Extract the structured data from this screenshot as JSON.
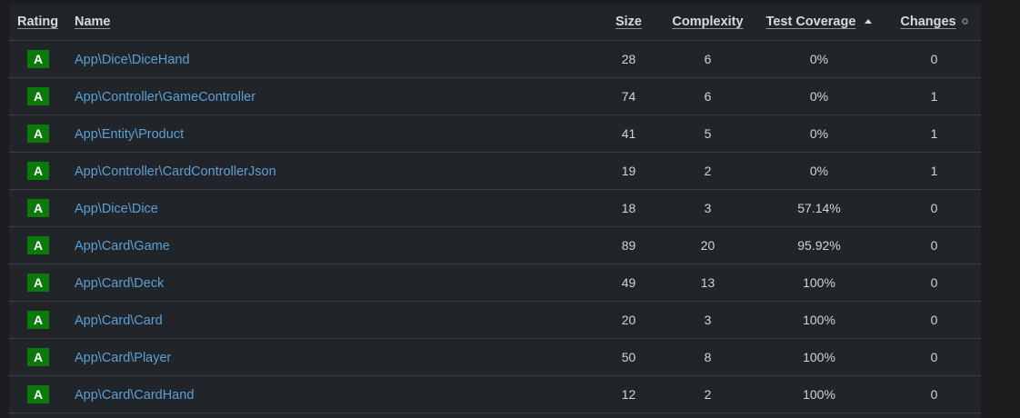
{
  "columns": {
    "rating": "Rating",
    "name": "Name",
    "size": "Size",
    "complexity": "Complexity",
    "coverage": "Test Coverage",
    "changes": "Changes"
  },
  "sort": {
    "active_column": "Test Coverage",
    "direction": "ascending"
  },
  "colors": {
    "rating_a": "#0b7a0b",
    "link": "#5b9fd6",
    "background": "#212529"
  },
  "rows": [
    {
      "rating": "A",
      "name": "App\\Dice\\DiceHand",
      "size": "28",
      "complexity": "6",
      "coverage": "0%",
      "changes": "0"
    },
    {
      "rating": "A",
      "name": "App\\Controller\\GameController",
      "size": "74",
      "complexity": "6",
      "coverage": "0%",
      "changes": "1"
    },
    {
      "rating": "A",
      "name": "App\\Entity\\Product",
      "size": "41",
      "complexity": "5",
      "coverage": "0%",
      "changes": "1"
    },
    {
      "rating": "A",
      "name": "App\\Controller\\CardControllerJson",
      "size": "19",
      "complexity": "2",
      "coverage": "0%",
      "changes": "1"
    },
    {
      "rating": "A",
      "name": "App\\Dice\\Dice",
      "size": "18",
      "complexity": "3",
      "coverage": "57.14%",
      "changes": "0"
    },
    {
      "rating": "A",
      "name": "App\\Card\\Game",
      "size": "89",
      "complexity": "20",
      "coverage": "95.92%",
      "changes": "0"
    },
    {
      "rating": "A",
      "name": "App\\Card\\Deck",
      "size": "49",
      "complexity": "13",
      "coverage": "100%",
      "changes": "0"
    },
    {
      "rating": "A",
      "name": "App\\Card\\Card",
      "size": "20",
      "complexity": "3",
      "coverage": "100%",
      "changes": "0"
    },
    {
      "rating": "A",
      "name": "App\\Card\\Player",
      "size": "50",
      "complexity": "8",
      "coverage": "100%",
      "changes": "0"
    },
    {
      "rating": "A",
      "name": "App\\Card\\CardHand",
      "size": "12",
      "complexity": "2",
      "coverage": "100%",
      "changes": "0"
    }
  ]
}
